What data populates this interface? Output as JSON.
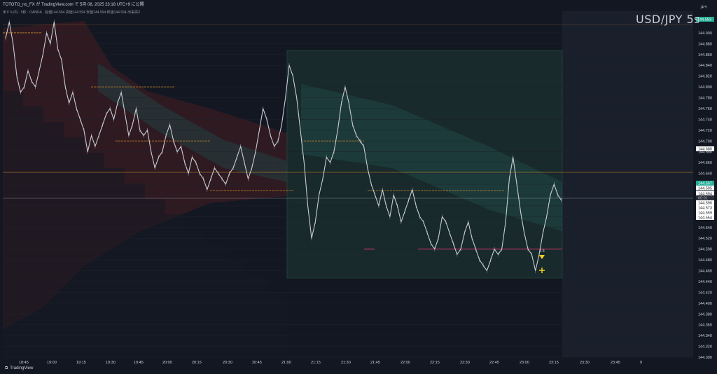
{
  "header": {
    "title": "TOTOTO_no_FX が TradingView.com で 5月 08, 2025 23:18 UTC+9 に公開",
    "subtitle_symbol": "米ドル/円 · 5秒 · OANDA",
    "ohlc": "始値144.594 高値144.594 安値144.594 終値144.594 出来高3",
    "big_symbol": "USD/JPY 5s"
  },
  "axis_label_top": "JPY",
  "footer": {
    "brand": "TradingView"
  },
  "colors": {
    "background": "#131722",
    "future_area": "#1a1f2c",
    "candle": "#c9ccd3",
    "green_zone": "#1d3a33",
    "red_zone": "#3a1c22",
    "orange_line": "#d1892a",
    "magenta_line": "#e0356d",
    "marker_yellow": "#f5d21e"
  },
  "markers": {
    "price_tag_top": "144.593",
    "signal_label": "2.3"
  },
  "price_tags": [
    {
      "text": "144.680",
      "style": "plain"
    },
    {
      "text": "144.597",
      "style": "green"
    },
    {
      "text": "144.595",
      "style": "plain"
    },
    {
      "text": "144.594",
      "style": "plain"
    },
    {
      "text": "00:01",
      "style": "grey"
    },
    {
      "text": "144.590",
      "style": "plain"
    },
    {
      "text": "144.573",
      "style": "plain"
    },
    {
      "text": "144.559",
      "style": "plain"
    },
    {
      "text": "144.554",
      "style": "plain"
    }
  ],
  "chart_data": {
    "type": "line",
    "title": "",
    "xlabel": "",
    "ylabel": "",
    "ylim": [
      144.3,
      144.94
    ],
    "y_ticks": [
      "144.900",
      "144.880",
      "144.860",
      "144.840",
      "144.820",
      "144.800",
      "144.780",
      "144.760",
      "144.740",
      "144.720",
      "144.700",
      "144.680",
      "144.660",
      "144.640",
      "144.620",
      "144.600",
      "144.580",
      "144.560",
      "144.540",
      "144.520",
      "144.500",
      "144.480",
      "144.460",
      "144.440",
      "144.420",
      "144.400",
      "144.380",
      "144.360",
      "144.340",
      "144.320",
      "144.300"
    ],
    "x_ticks": [
      "18:45",
      "19:00",
      "19:15",
      "19:30",
      "19:45",
      "20:00",
      "20:15",
      "20:30",
      "20:45",
      "21:00",
      "21:15",
      "21:30",
      "21:45",
      "22:00",
      "22:15",
      "22:30",
      "22:45",
      "23:00",
      "23:15",
      "23:30",
      "23:45",
      "9"
    ],
    "series": [
      {
        "values": [
          144.89,
          144.92,
          144.88,
          144.82,
          144.79,
          144.8,
          144.83,
          144.81,
          144.8,
          144.83,
          144.86,
          144.9,
          144.88,
          144.92,
          144.87,
          144.85,
          144.8,
          144.77,
          144.79,
          144.76,
          144.74,
          144.72,
          144.68,
          144.71,
          144.69,
          144.71,
          144.73,
          144.75,
          144.76,
          144.74,
          144.77,
          144.79,
          144.75,
          144.71,
          144.73,
          144.76,
          144.72,
          144.71,
          144.72,
          144.68,
          144.65,
          144.67,
          144.68,
          144.71,
          144.73,
          144.7,
          144.68,
          144.69,
          144.66,
          144.64,
          144.67,
          144.66,
          144.64,
          144.63,
          144.61,
          144.63,
          144.65,
          144.64,
          144.63,
          144.62,
          144.64,
          144.65,
          144.67,
          144.69,
          144.66,
          144.63,
          144.65,
          144.68,
          144.72,
          144.76,
          144.74,
          144.71,
          144.69,
          144.7,
          144.73,
          144.78,
          144.84,
          144.82,
          144.78,
          144.72,
          144.66,
          144.58,
          144.52,
          144.55,
          144.6,
          144.63,
          144.67,
          144.66,
          144.68,
          144.72,
          144.77,
          144.8,
          144.77,
          144.73,
          144.71,
          144.7,
          144.69,
          144.65,
          144.62,
          144.6,
          144.58,
          144.61,
          144.58,
          144.56,
          144.6,
          144.58,
          144.55,
          144.57,
          144.59,
          144.61,
          144.58,
          144.56,
          144.55,
          144.53,
          144.51,
          144.5,
          144.52,
          144.56,
          144.55,
          144.53,
          144.51,
          144.49,
          144.5,
          144.53,
          144.55,
          144.52,
          144.5,
          144.48,
          144.47,
          144.46,
          144.48,
          144.5,
          144.49,
          144.5,
          144.55,
          144.63,
          144.67,
          144.62,
          144.57,
          144.53,
          144.5,
          144.49,
          144.46,
          144.49,
          144.53,
          144.56,
          144.6,
          144.62,
          144.6,
          144.59
        ]
      }
    ]
  }
}
